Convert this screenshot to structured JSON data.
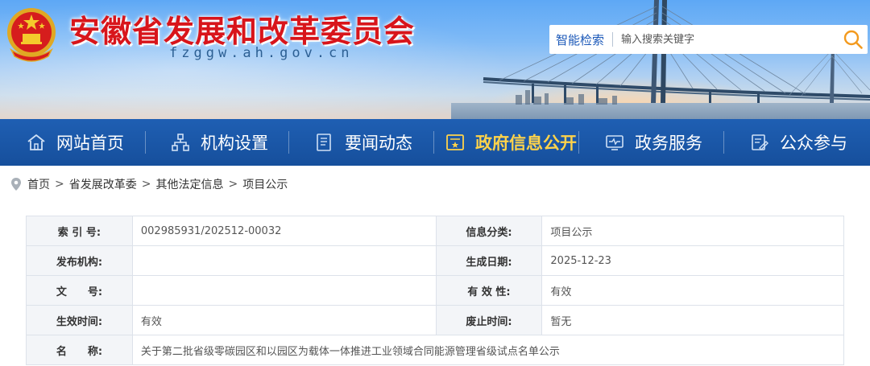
{
  "header": {
    "title": "安徽省发展和改革委员会",
    "domain": "fzggw.ah.gov.cn",
    "search": {
      "label": "智能检索",
      "placeholder": "输入搜索关键字",
      "icon": "search-icon"
    }
  },
  "nav": {
    "items": [
      {
        "label": "网站首页",
        "icon": "home-icon"
      },
      {
        "label": "机构设置",
        "icon": "org-chart-icon"
      },
      {
        "label": "要闻动态",
        "icon": "news-icon"
      },
      {
        "label": "政府信息公开",
        "icon": "info-public-icon",
        "active": true
      },
      {
        "label": "政务服务",
        "icon": "service-monitor-icon"
      },
      {
        "label": "公众参与",
        "icon": "participation-icon"
      }
    ]
  },
  "breadcrumb": {
    "icon": "location-pin-icon",
    "items": [
      "首页",
      "省发展改革委",
      "其他法定信息",
      "项目公示"
    ],
    "separator": ">"
  },
  "info": {
    "rows": [
      {
        "l1": "索 引 号:",
        "v1": "002985931/202512-00032",
        "l2": "信息分类:",
        "v2": "项目公示"
      },
      {
        "l1": "发布机构:",
        "v1": "",
        "l2": "生成日期:",
        "v2": "2025-12-23"
      },
      {
        "l1": "文　　号:",
        "v1": "",
        "l2": "有 效 性:",
        "v2": "有效"
      },
      {
        "l1": "生效时间:",
        "v1": "有效",
        "l2": "废止时间:",
        "v2": "暂无"
      }
    ],
    "name_label": "名　　称:",
    "name_value": "关于第二批省级零碳园区和以园区为载体一体推进工业领域合同能源管理省级试点名单公示"
  },
  "colors": {
    "title_red": "#d8151b",
    "nav_blue": "#1f5fb3",
    "nav_active": "#ffd34a",
    "search_orange": "#f39a1e"
  }
}
